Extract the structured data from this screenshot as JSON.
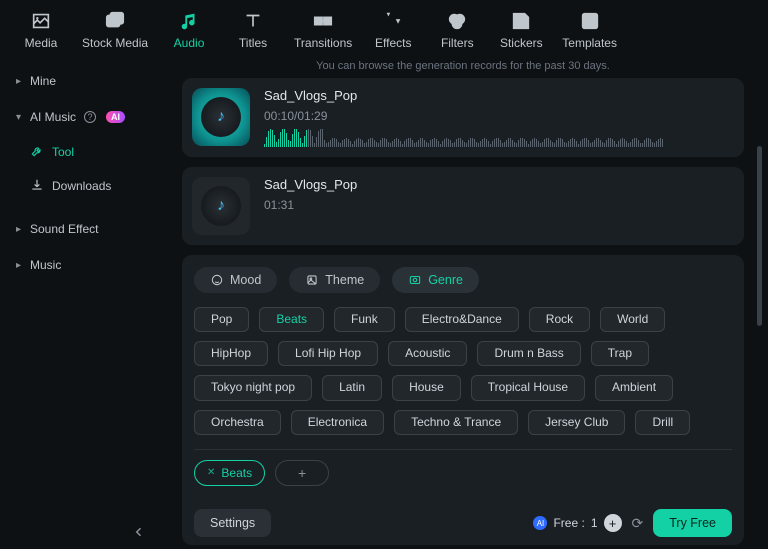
{
  "nav": {
    "items": [
      {
        "key": "media",
        "label": "Media"
      },
      {
        "key": "stock-media",
        "label": "Stock Media"
      },
      {
        "key": "audio",
        "label": "Audio"
      },
      {
        "key": "titles",
        "label": "Titles"
      },
      {
        "key": "transitions",
        "label": "Transitions"
      },
      {
        "key": "effects",
        "label": "Effects"
      },
      {
        "key": "filters",
        "label": "Filters"
      },
      {
        "key": "stickers",
        "label": "Stickers"
      },
      {
        "key": "templates",
        "label": "Templates"
      }
    ],
    "active_index": 2
  },
  "sidebar": {
    "items": [
      {
        "label": "Mine",
        "caret": "right"
      },
      {
        "label": "AI Music",
        "caret": "down",
        "help": true,
        "ai_badge": "AI"
      },
      {
        "label": "Sound Effect",
        "caret": "right"
      },
      {
        "label": "Music",
        "caret": "right"
      }
    ],
    "subs": [
      {
        "label": "Tool",
        "icon": "tool",
        "active": true
      },
      {
        "label": "Downloads",
        "icon": "download",
        "active": false
      }
    ]
  },
  "hint_text": "You can browse the generation records for the past 30 days.",
  "tracks": [
    {
      "title": "Sad_Vlogs_Pop",
      "time": "00:10/01:29",
      "has_wave": true,
      "highlight": true
    },
    {
      "title": "Sad_Vlogs_Pop",
      "time": "01:31",
      "has_wave": false,
      "highlight": false
    }
  ],
  "filter_tabs": {
    "items": [
      {
        "key": "mood",
        "label": "Mood"
      },
      {
        "key": "theme",
        "label": "Theme"
      },
      {
        "key": "genre",
        "label": "Genre"
      }
    ],
    "active_index": 2
  },
  "genre_tags": [
    "Pop",
    "Beats",
    "Funk",
    "Electro&Dance",
    "Rock",
    "World",
    "HipHop",
    "Lofi Hip Hop",
    "Acoustic",
    "Drum n Bass",
    "Trap",
    "Tokyo night pop",
    "Latin",
    "House",
    "Tropical House",
    "Ambient",
    "Orchestra",
    "Electronica",
    "Techno & Trance",
    "Jersey Club",
    "Drill"
  ],
  "active_genre_index": 1,
  "selected_tags": [
    "Beats"
  ],
  "bottom": {
    "settings_label": "Settings",
    "free_label": "Free :",
    "free_count": "1",
    "try_label": "Try Free"
  }
}
